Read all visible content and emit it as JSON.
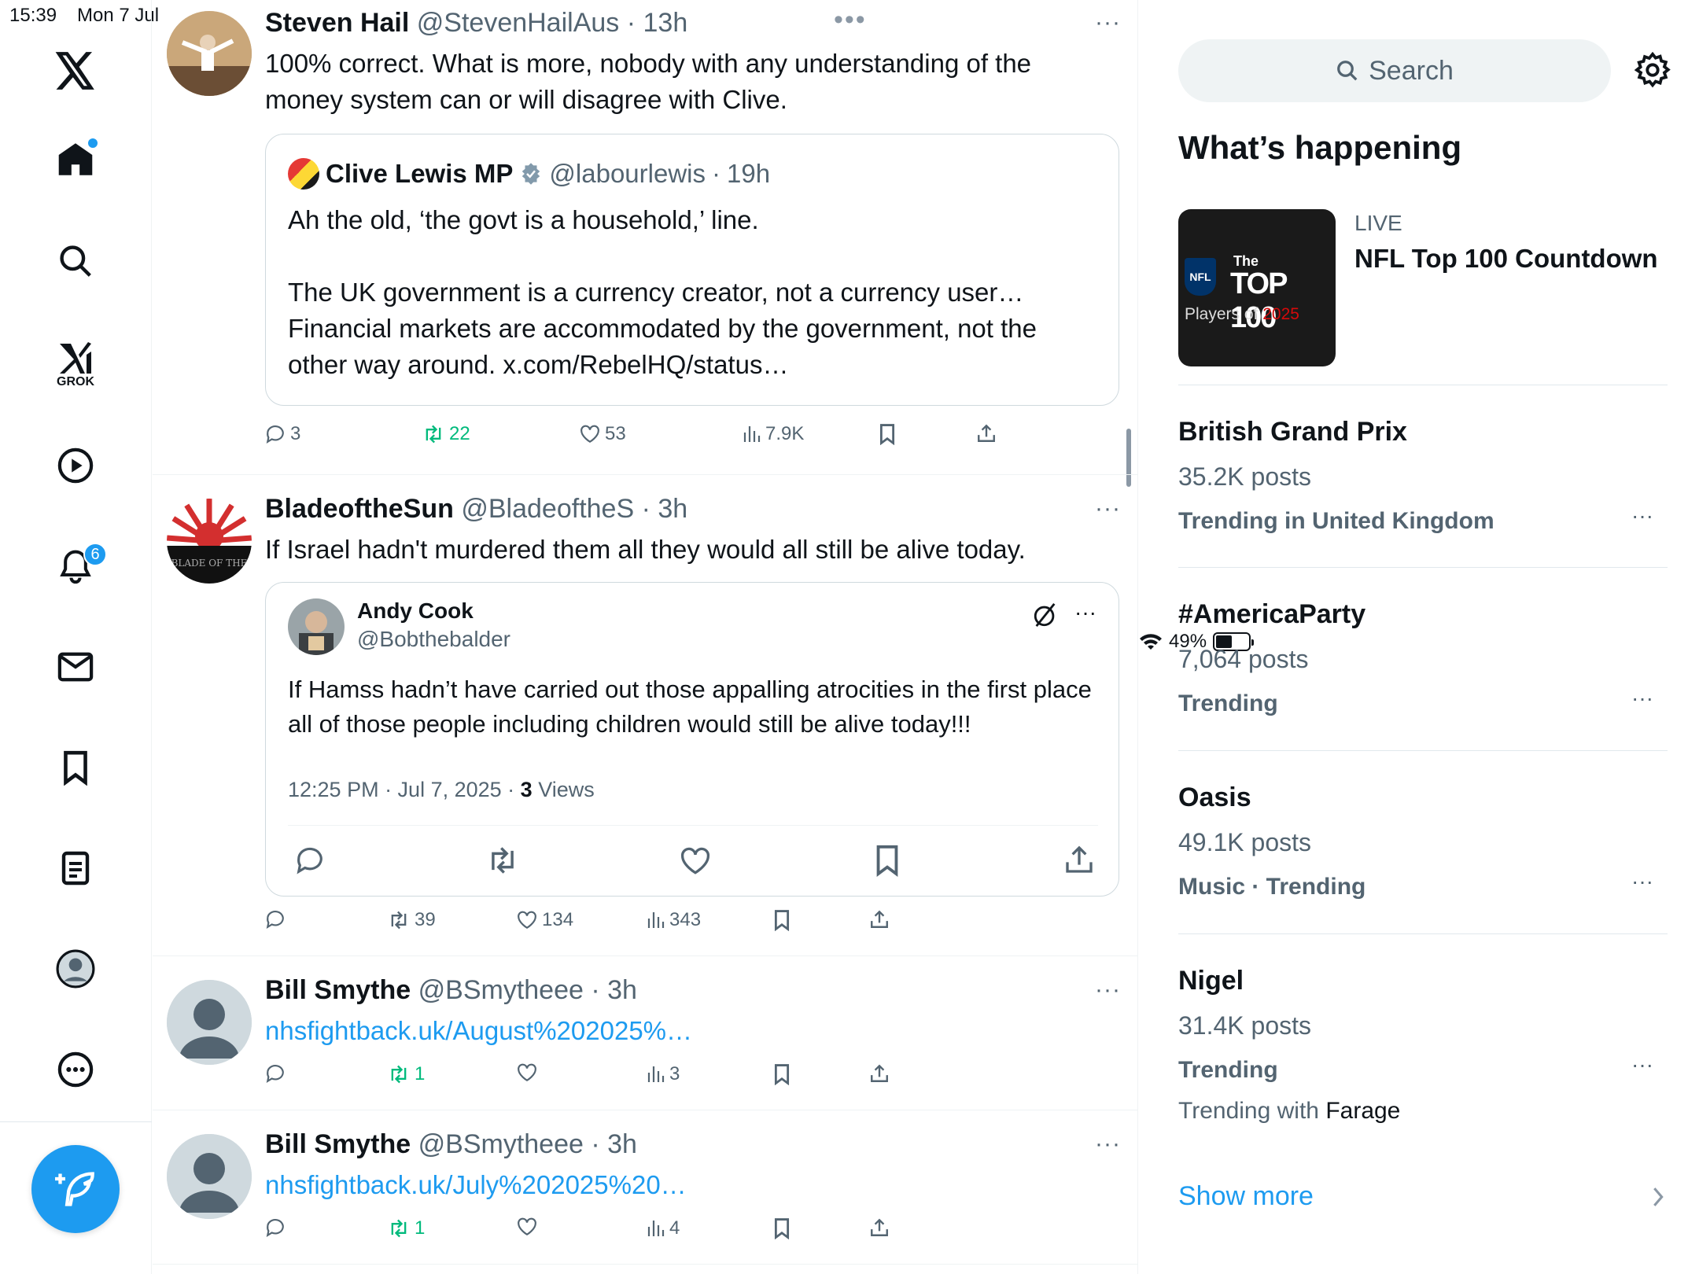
{
  "status": {
    "time": "15:39",
    "date": "Mon 7 Jul",
    "battery": "49%",
    "battery_level": 0.49
  },
  "nav": {
    "grok_label": "GROK",
    "notifications_count": "6"
  },
  "tweets": [
    {
      "name": "Steven Hail",
      "handle": "@StevenHailAus",
      "time": "13h",
      "text": "100% correct. What is more, nobody with any understanding of the money system can or will disagree with Clive.",
      "quote": {
        "name": "Clive Lewis MP",
        "handle": "@labourlewis",
        "time": "19h",
        "line1": "Ah the old, ‘the govt is a household,’ line.",
        "line2": "The UK government is a currency creator, not a currency user… Financial markets are accommodated by the government, not the other way around. x.com/RebelHQ/status…"
      },
      "replies": "3",
      "reposts": "22",
      "likes": "53",
      "views": "7.9K"
    },
    {
      "name": "BladeoftheSun",
      "handle": "@BladeoftheS",
      "time": "3h",
      "text": "If Israel hadn't murdered them all they would all still be alive today.",
      "avatar_text": "BLADE OF THE",
      "quote": {
        "name": "Andy Cook",
        "handle": "@Bobthebalder",
        "text": "If Hamss hadn’t have carried out those appalling atrocities in the first place all of those people including children would still be alive today!!!",
        "timestamp": "12:25 PM · Jul 7, 2025 · ",
        "views_num": "3",
        "views_label": " Views"
      },
      "replies": "",
      "reposts": "39",
      "likes": "134",
      "views": "343"
    },
    {
      "name": "Bill Smythe",
      "handle": "@BSmytheee",
      "time": "3h",
      "link": "nhsfightback.uk/August%202025%…",
      "replies": "",
      "reposts": "1",
      "likes": "",
      "views": "3"
    },
    {
      "name": "Bill Smythe",
      "handle": "@BSmytheee",
      "time": "3h",
      "link": "nhsfightback.uk/July%202025%20…",
      "replies": "",
      "reposts": "1",
      "likes": "",
      "views": "4"
    }
  ],
  "sidebar": {
    "search_placeholder": "Search",
    "whats_happening": "What’s happening",
    "live": {
      "label": "LIVE",
      "title": "NFL Top 100 Countdown",
      "thumb_line1": "The",
      "thumb_line2": "TOP 100",
      "thumb_line3": "Players of",
      "thumb_year": "2025",
      "thumb_badge": "NFL"
    },
    "trends": [
      {
        "name": "British Grand Prix",
        "posts": "35.2K posts",
        "context": "Trending in United Kingdom"
      },
      {
        "name": "#AmericaParty",
        "posts": "7,064 posts",
        "context": "Trending"
      },
      {
        "name": "Oasis",
        "posts": "49.1K posts",
        "context": "Music · Trending"
      },
      {
        "name": "Nigel",
        "posts": "31.4K posts",
        "context": "Trending",
        "with_prefix": "Trending with ",
        "with_name": "Farage"
      }
    ],
    "show_more": "Show more"
  }
}
